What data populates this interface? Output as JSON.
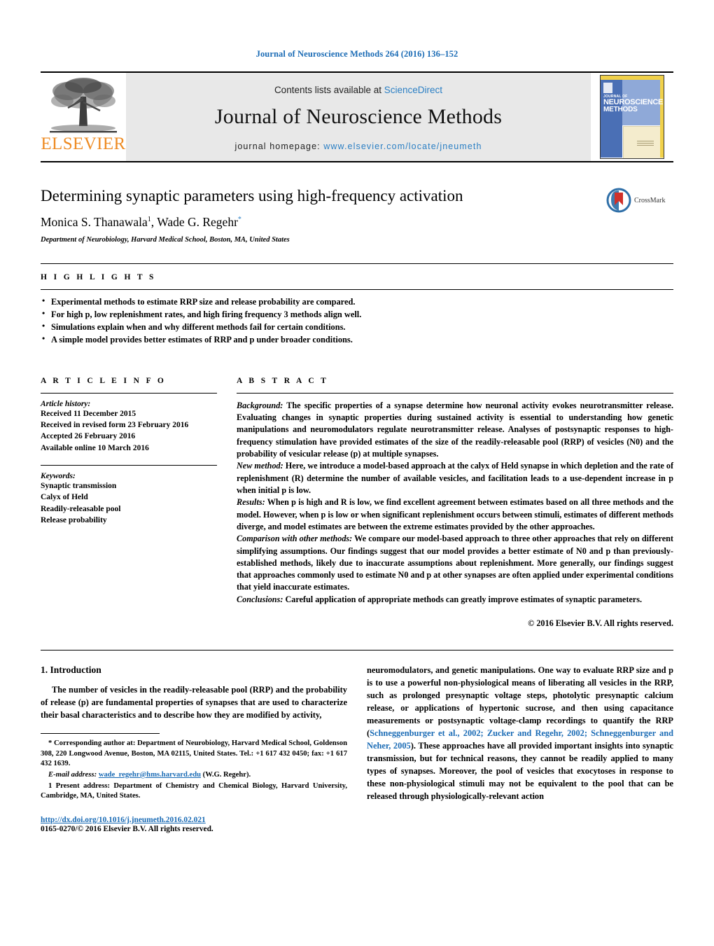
{
  "running_head": "Journal of Neuroscience Methods 264 (2016) 136–152",
  "masthead": {
    "publisher_logo_text": "ELSEVIER",
    "contents_prefix": "Contents lists available at ",
    "contents_link": "ScienceDirect",
    "journal_title": "Journal of Neuroscience Methods",
    "homepage_prefix": "journal homepage: ",
    "homepage_url": "www.elsevier.com/locate/jneumeth",
    "cover": {
      "line1": "JOURNAL OF",
      "line2": "NEUROSCIENCE",
      "line3": "METHODS"
    }
  },
  "article": {
    "title": "Determining synaptic parameters using high-frequency activation",
    "authors_part1": "Monica S. Thanawala",
    "authors_sup1": "1",
    "authors_part2": ", Wade G. Regehr",
    "authors_star": "*",
    "affiliation": "Department of Neurobiology, Harvard Medical School, Boston, MA, United States",
    "crossmark_label": "CrossMark"
  },
  "highlights": {
    "heading": "H I G H L I G H T S",
    "items": [
      "Experimental methods to estimate RRP size and release probability are compared.",
      "For high p, low replenishment rates, and high firing frequency 3 methods align well.",
      "Simulations explain when and why different methods fail for certain conditions.",
      "A simple model provides better estimates of RRP and p under broader conditions."
    ]
  },
  "article_info": {
    "heading": "A R T I C L E    I N F O",
    "history_label": "Article history:",
    "history_lines": [
      "Received 11 December 2015",
      "Received in revised form 23 February 2016",
      "Accepted 26 February 2016",
      "Available online 10 March 2016"
    ],
    "keywords_label": "Keywords:",
    "keywords": [
      "Synaptic transmission",
      "Calyx of Held",
      "Readily-releasable pool",
      "Release probability"
    ]
  },
  "abstract": {
    "heading": "A B S T R A C T",
    "paragraphs": [
      {
        "label": "Background:",
        "text": " The specific properties of a synapse determine how neuronal activity evokes neurotransmitter release. Evaluating changes in synaptic properties during sustained activity is essential to understanding how genetic manipulations and neuromodulators regulate neurotransmitter release. Analyses of postsynaptic responses to high-frequency stimulation have provided estimates of the size of the readily-releasable pool (RRP) of vesicles (N0) and the probability of vesicular release (p) at multiple synapses."
      },
      {
        "label": "New method:",
        "text": " Here, we introduce a model-based approach at the calyx of Held synapse in which depletion and the rate of replenishment (R) determine the number of available vesicles, and facilitation leads to a use-dependent increase in p when initial p is low."
      },
      {
        "label": "Results:",
        "text": " When p is high and R is low, we find excellent agreement between estimates based on all three methods and the model. However, when p is low or when significant replenishment occurs between stimuli, estimates of different methods diverge, and model estimates are between the extreme estimates provided by the other approaches."
      },
      {
        "label": "Comparison with other methods:",
        "text": " We compare our model-based approach to three other approaches that rely on different simplifying assumptions. Our findings suggest that our model provides a better estimate of N0 and p than previously-established methods, likely due to inaccurate assumptions about replenishment. More generally, our findings suggest that approaches commonly used to estimate N0 and p at other synapses are often applied under experimental conditions that yield inaccurate estimates."
      },
      {
        "label": "Conclusions:",
        "text": " Careful application of appropriate methods can greatly improve estimates of synaptic parameters."
      }
    ],
    "copyright": "© 2016 Elsevier B.V. All rights reserved."
  },
  "body": {
    "section_number_title": "1.  Introduction",
    "left_paragraph": "The number of vesicles in the readily-releasable pool (RRP) and the probability of release (p) are fundamental properties of synapses that are used to characterize their basal characteristics and to describe how they are modified by activity,",
    "right_paragraph_pre": "neuromodulators, and genetic manipulations. One way to evaluate RRP size and p is to use a powerful non-physiological means of liberating all vesicles in the RRP, such as prolonged presynaptic voltage steps, photolytic presynaptic calcium release, or applications of hypertonic sucrose, and then using capacitance measurements or postsynaptic voltage-clamp recordings to quantify the RRP (",
    "right_citation": "Schneggenburger et al., 2002; Zucker and Regehr, 2002; Schneggenburger and Neher, 2005",
    "right_paragraph_post": "). These approaches have all provided important insights into synaptic transmission, but for technical reasons, they cannot be readily applied to many types of synapses. Moreover, the pool of vesicles that exocytoses in response to these non-physiological stimuli may not be equivalent to the pool that can be released through physiologically-relevant action"
  },
  "footnotes": {
    "corresponding": "* Corresponding author at: Department of Neurobiology, Harvard Medical School, Goldenson 308, 220 Longwood Avenue, Boston, MA 02115, United States. Tel.: +1 617 432 0450; fax: +1 617 432 1639.",
    "email_label": "E-mail address:",
    "email": "wade_regehr@hms.harvard.edu",
    "email_suffix": " (W.G. Regehr).",
    "present_address": "1 Present address: Department of Chemistry and Chemical Biology, Harvard University, Cambridge, MA, United States."
  },
  "imprint": {
    "doi": "http://dx.doi.org/10.1016/j.jneumeth.2016.02.021",
    "issn_copyright": "0165-0270/© 2016 Elsevier B.V. All rights reserved."
  },
  "colors": {
    "link_blue": "#1a6bb5",
    "sciencedirect_blue": "#2b7fc4",
    "elsevier_orange": "#ee8c25"
  }
}
